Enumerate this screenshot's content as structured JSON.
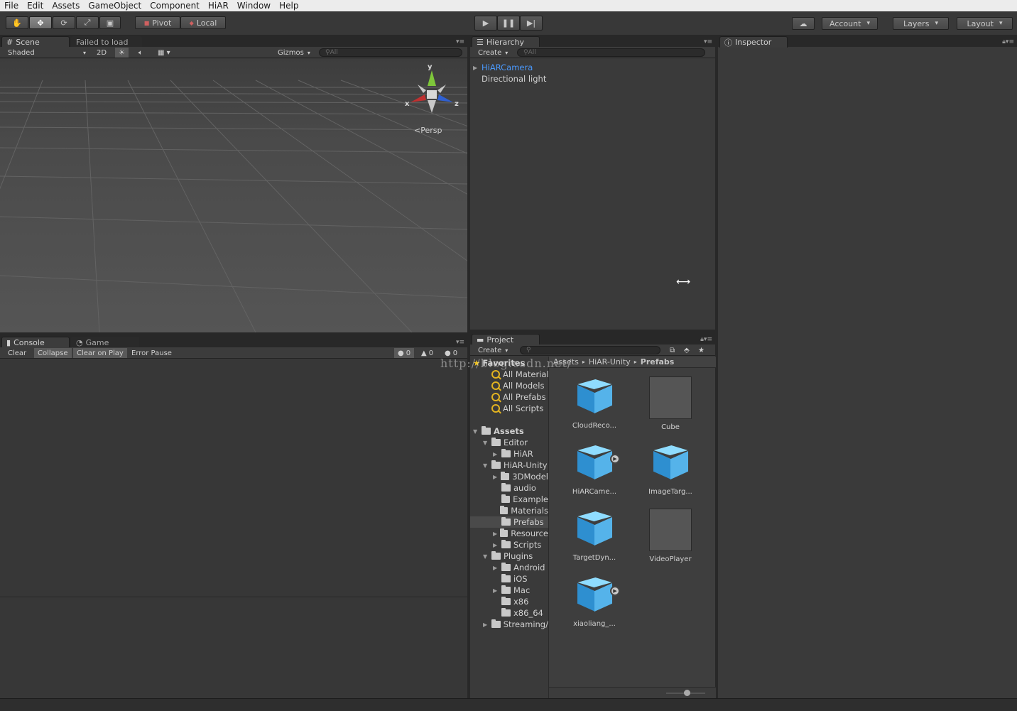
{
  "menu": [
    "File",
    "Edit",
    "Assets",
    "GameObject",
    "Component",
    "HiAR",
    "Window",
    "Help"
  ],
  "toolbar": {
    "pivot": "Pivot",
    "local": "Local",
    "account": "Account",
    "layers": "Layers",
    "layout": "Layout"
  },
  "scene": {
    "tab": "Scene",
    "tab_status": "Failed to load",
    "shading": "Shaded",
    "mode2d": "2D",
    "gizmos": "Gizmos",
    "search_placeholder": "All",
    "axis_x": "x",
    "axis_y": "y",
    "axis_z": "z",
    "persp": "Persp"
  },
  "hierarchy": {
    "tab": "Hierarchy",
    "create": "Create",
    "search_placeholder": "All",
    "items": [
      "HiARCamera",
      "Directional light"
    ]
  },
  "inspector": {
    "tab": "Inspector"
  },
  "console": {
    "tab": "Console",
    "tab2": "Game",
    "buttons": [
      "Clear",
      "Collapse",
      "Clear on Play",
      "Error Pause"
    ],
    "counts": [
      "0",
      "0",
      "0"
    ]
  },
  "project": {
    "tab": "Project",
    "create": "Create",
    "breadcrumb": [
      "Assets",
      "HiAR-Unity",
      "Prefabs"
    ],
    "favorites_label": "Favorites",
    "favorites": [
      "All Material",
      "All Models",
      "All Prefabs",
      "All Scripts"
    ],
    "tree": [
      {
        "label": "Assets",
        "depth": 0,
        "arrow": "▼",
        "bold": true
      },
      {
        "label": "Editor",
        "depth": 1,
        "arrow": "▼"
      },
      {
        "label": "HiAR",
        "depth": 2,
        "arrow": "▶"
      },
      {
        "label": "HiAR-Unity",
        "depth": 1,
        "arrow": "▼"
      },
      {
        "label": "3DModel",
        "depth": 2,
        "arrow": "▶"
      },
      {
        "label": "audio",
        "depth": 2,
        "arrow": ""
      },
      {
        "label": "Example",
        "depth": 2,
        "arrow": ""
      },
      {
        "label": "Materials",
        "depth": 2,
        "arrow": ""
      },
      {
        "label": "Prefabs",
        "depth": 2,
        "arrow": "",
        "selected": true
      },
      {
        "label": "Resource",
        "depth": 2,
        "arrow": "▶"
      },
      {
        "label": "Scripts",
        "depth": 2,
        "arrow": "▶"
      },
      {
        "label": "Plugins",
        "depth": 1,
        "arrow": "▼"
      },
      {
        "label": "Android",
        "depth": 2,
        "arrow": "▶"
      },
      {
        "label": "iOS",
        "depth": 2,
        "arrow": ""
      },
      {
        "label": "Mac",
        "depth": 2,
        "arrow": "▶"
      },
      {
        "label": "x86",
        "depth": 2,
        "arrow": ""
      },
      {
        "label": "x86_64",
        "depth": 2,
        "arrow": ""
      },
      {
        "label": "Streaming/",
        "depth": 1,
        "arrow": "▶"
      }
    ],
    "assets": [
      {
        "label": "CloudReco...",
        "kind": "cube"
      },
      {
        "label": "Cube",
        "kind": "grey"
      },
      {
        "label": "HiARCame...",
        "kind": "cube",
        "badge": true
      },
      {
        "label": "ImageTarg...",
        "kind": "cube"
      },
      {
        "label": "TargetDyn...",
        "kind": "cube"
      },
      {
        "label": "VideoPlayer",
        "kind": "grey"
      },
      {
        "label": "xiaoliang_...",
        "kind": "cube",
        "badge": true
      }
    ]
  },
  "watermark": "http://blog.csdn.net/"
}
